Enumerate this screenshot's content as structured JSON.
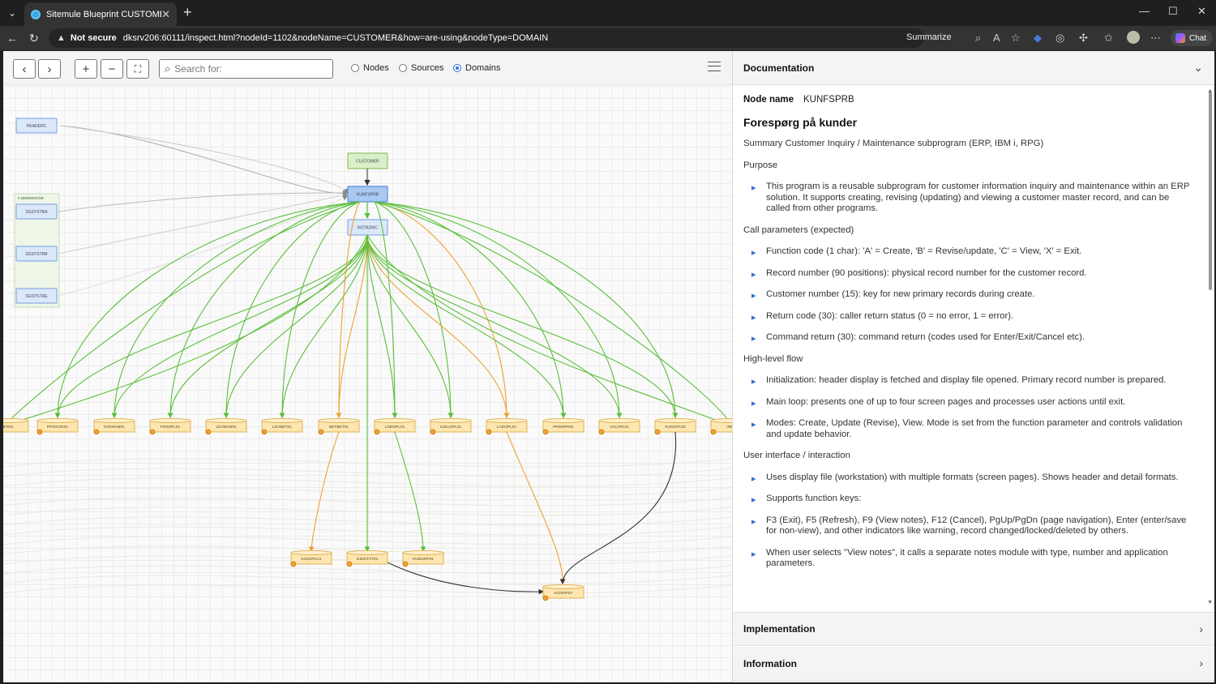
{
  "browser": {
    "tab_title": "Sitemule Blueprint CUSTOMER",
    "security_label": "Not secure",
    "url": "dksrv206:60111/inspect.html?nodeId=1102&nodeName=CUSTOMER&how=are-using&nodeType=DOMAIN",
    "summarize_label": "Summarize",
    "chat_label": "Chat"
  },
  "toolbar": {
    "search_placeholder": "Search for:",
    "radio_nodes": "Nodes",
    "radio_sources": "Sources",
    "radio_domains": "Domains",
    "selected": "Domains"
  },
  "graph": {
    "nodes": [
      "HEADERC",
      "GENERATOR",
      "SGSYSTRA",
      "SGSYSTRB",
      "SGSYSTRE",
      "CUSTOMER",
      "KUNFSPRB",
      "NOTADMC",
      "PROKOD01",
      "KONRAB01",
      "FRI03PL01",
      "LEVMAD01",
      "LEVBET01",
      "BETBET01",
      "LNDOPL01",
      "SJELOPL01",
      "LADOPL01",
      "PRMSPR01",
      "VALOPL01",
      "KUNOPL02",
      "KUNOPL01",
      "KJEDTXT01",
      "KUNGRP01",
      "KUNOPLF"
    ]
  },
  "documentation": {
    "header": "Documentation",
    "node_name_label": "Node name",
    "node_name_value": "KUNFSPRB",
    "title": "Forespørg på kunder",
    "summary": "Summary Customer Inquiry / Maintenance subprogram (ERP, IBM i, RPG)",
    "purpose_heading": "Purpose",
    "purpose_items": [
      "This program is a reusable subprogram for customer information inquiry and maintenance within an ERP solution. It supports creating, revising (updating) and viewing a customer master record, and can be called from other programs."
    ],
    "call_heading": "Call parameters (expected)",
    "call_items": [
      "Function code (1 char): 'A' = Create, 'B' = Revise/update, 'C' = View, 'X' = Exit.",
      "Record number (90 positions): physical record number for the customer record.",
      "Customer number (15): key for new primary records during create.",
      "Return code (30): caller return status (0 = no error, 1 = error).",
      "Command return (30): command return (codes used for Enter/Exit/Cancel etc)."
    ],
    "flow_heading": "High-level flow",
    "flow_items": [
      "Initialization: header display is fetched and display file opened. Primary record number is prepared.",
      "Main loop: presents one of up to four screen pages and processes user actions until exit.",
      "Modes: Create, Update (Revise), View. Mode is set from the function parameter and controls validation and update behavior."
    ],
    "ui_heading": "User interface / interaction",
    "ui_items": [
      "Uses display file (workstation) with multiple formats (screen pages). Shows header and detail formats.",
      "Supports function keys:",
      "F3 (Exit), F5 (Refresh), F9 (View notes), F12 (Cancel), PgUp/PgDn (page navigation), Enter (enter/save for non-view), and other indicators like warning, record changed/locked/deleted by others.",
      "When user selects \"View notes\", it calls a separate notes module with type, number and application parameters."
    ]
  },
  "implementation_header": "Implementation",
  "information_header": "Information"
}
